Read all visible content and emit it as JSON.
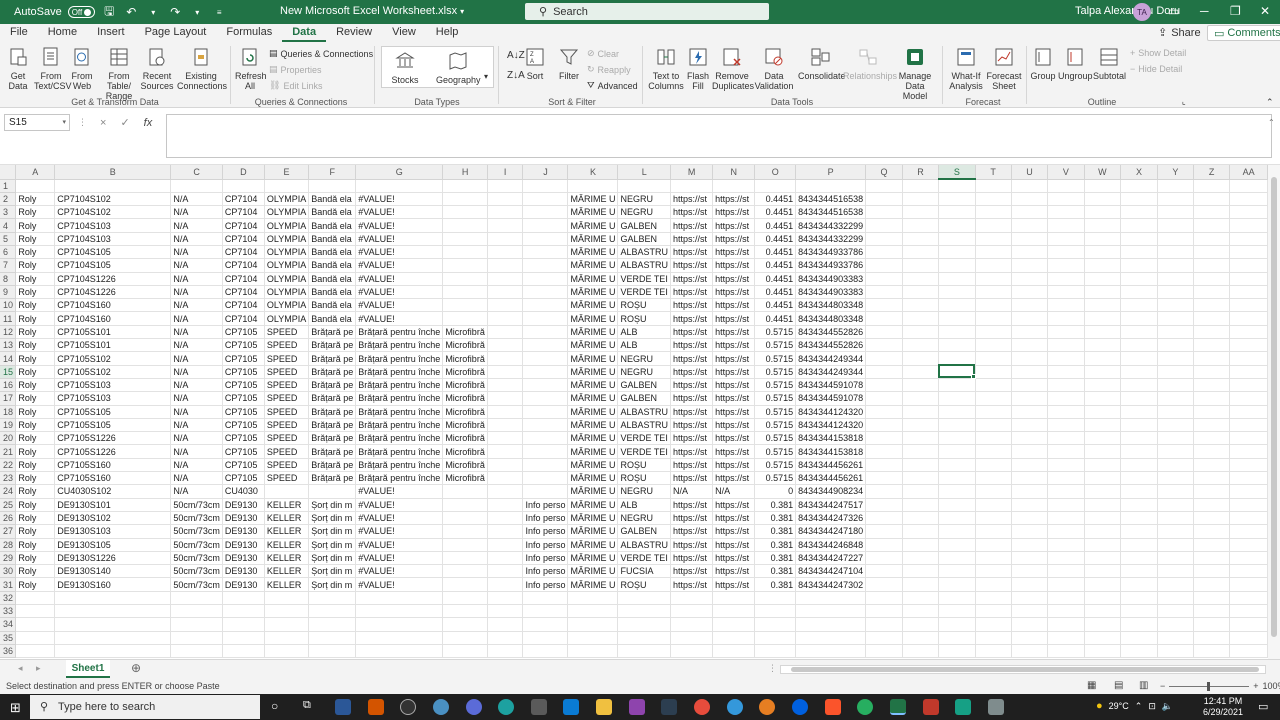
{
  "titlebar": {
    "autosave_label": "AutoSave",
    "autosave_state": "Off",
    "filename": "New Microsoft Excel Worksheet.xlsx",
    "search_placeholder": "Search",
    "user": "Talpa Alexandru Doru",
    "avatar": "TA"
  },
  "menu": {
    "tabs": [
      "File",
      "Home",
      "Insert",
      "Page Layout",
      "Formulas",
      "Data",
      "Review",
      "View",
      "Help"
    ],
    "active": "Data",
    "share": "Share",
    "comments": "Comments"
  },
  "ribbon": {
    "get_data": "Get Data",
    "from_text": "From Text/CSV",
    "from_web": "From Web",
    "from_table": "From Table/ Range",
    "recent_sources": "Recent Sources",
    "existing_connections": "Existing Connections",
    "refresh_all": "Refresh All",
    "queries_connections": "Queries & Connections",
    "properties": "Properties",
    "edit_links": "Edit Links",
    "stocks": "Stocks",
    "geography": "Geography",
    "sort": "Sort",
    "filter": "Filter",
    "clear": "Clear",
    "reapply": "Reapply",
    "advanced": "Advanced",
    "text_to_columns": "Text to Columns",
    "flash_fill": "Flash Fill",
    "remove_duplicates": "Remove Duplicates",
    "data_validation": "Data Validation",
    "consolidate": "Consolidate",
    "relationships": "Relationships",
    "manage_data_model": "Manage Data Model",
    "what_if": "What-If Analysis",
    "forecast_sheet": "Forecast Sheet",
    "group": "Group",
    "ungroup": "Ungroup",
    "subtotal": "Subtotal",
    "show_detail": "Show Detail",
    "hide_detail": "Hide Detail",
    "groups": {
      "get_transform": "Get & Transform Data",
      "queries": "Queries & Connections",
      "data_types": "Data Types",
      "sort_filter": "Sort & Filter",
      "data_tools": "Data Tools",
      "forecast": "Forecast",
      "outline": "Outline"
    }
  },
  "formula_bar": {
    "name_box": "S15",
    "cancel_icon": "×",
    "enter_icon": "✓",
    "fx": "fx",
    "value": ""
  },
  "grid": {
    "columns": [
      "A",
      "B",
      "C",
      "D",
      "E",
      "F",
      "G",
      "H",
      "I",
      "J",
      "K",
      "L",
      "M",
      "N",
      "O",
      "P",
      "Q",
      "R",
      "S",
      "T",
      "U",
      "V",
      "W",
      "X",
      "Y",
      "Z",
      "AA"
    ],
    "selected_column": "S",
    "selected_row": "15",
    "rows": [
      {
        "n": "1",
        "c": [
          "",
          "",
          "",
          "",
          "",
          "",
          "",
          "",
          "",
          "",
          "",
          "",
          "",
          "",
          "",
          "",
          ""
        ]
      },
      {
        "n": "2",
        "c": [
          "Roly",
          "CP7104S102",
          "N/A",
          "CP7104",
          "OLYMPIA",
          "Bandă ela",
          "#VALUE!",
          "",
          "",
          "",
          "MĂRIME U",
          "NEGRU",
          "https://st",
          "https://st",
          "0.4451",
          "8434344516538",
          ""
        ]
      },
      {
        "n": "3",
        "c": [
          "Roly",
          "CP7104S102",
          "N/A",
          "CP7104",
          "OLYMPIA",
          "Bandă ela",
          "#VALUE!",
          "",
          "",
          "",
          "MĂRIME U",
          "NEGRU",
          "https://st",
          "https://st",
          "0.4451",
          "8434344516538",
          ""
        ]
      },
      {
        "n": "4",
        "c": [
          "Roly",
          "CP7104S103",
          "N/A",
          "CP7104",
          "OLYMPIA",
          "Bandă ela",
          "#VALUE!",
          "",
          "",
          "",
          "MĂRIME U",
          "GALBEN",
          "https://st",
          "https://st",
          "0.4451",
          "8434344332299",
          ""
        ]
      },
      {
        "n": "5",
        "c": [
          "Roly",
          "CP7104S103",
          "N/A",
          "CP7104",
          "OLYMPIA",
          "Bandă ela",
          "#VALUE!",
          "",
          "",
          "",
          "MĂRIME U",
          "GALBEN",
          "https://st",
          "https://st",
          "0.4451",
          "8434344332299",
          ""
        ]
      },
      {
        "n": "6",
        "c": [
          "Roly",
          "CP7104S105",
          "N/A",
          "CP7104",
          "OLYMPIA",
          "Bandă ela",
          "#VALUE!",
          "",
          "",
          "",
          "MĂRIME U",
          "ALBASTRU",
          "https://st",
          "https://st",
          "0.4451",
          "8434344933786",
          ""
        ]
      },
      {
        "n": "7",
        "c": [
          "Roly",
          "CP7104S105",
          "N/A",
          "CP7104",
          "OLYMPIA",
          "Bandă ela",
          "#VALUE!",
          "",
          "",
          "",
          "MĂRIME U",
          "ALBASTRU",
          "https://st",
          "https://st",
          "0.4451",
          "8434344933786",
          ""
        ]
      },
      {
        "n": "8",
        "c": [
          "Roly",
          "CP7104S1226",
          "N/A",
          "CP7104",
          "OLYMPIA",
          "Bandă ela",
          "#VALUE!",
          "",
          "",
          "",
          "MĂRIME U",
          "VERDE TEI",
          "https://st",
          "https://st",
          "0.4451",
          "8434344903383",
          ""
        ]
      },
      {
        "n": "9",
        "c": [
          "Roly",
          "CP7104S1226",
          "N/A",
          "CP7104",
          "OLYMPIA",
          "Bandă ela",
          "#VALUE!",
          "",
          "",
          "",
          "MĂRIME U",
          "VERDE TEI",
          "https://st",
          "https://st",
          "0.4451",
          "8434344903383",
          ""
        ]
      },
      {
        "n": "10",
        "c": [
          "Roly",
          "CP7104S160",
          "N/A",
          "CP7104",
          "OLYMPIA",
          "Bandă ela",
          "#VALUE!",
          "",
          "",
          "",
          "MĂRIME U",
          "ROȘU",
          "https://st",
          "https://st",
          "0.4451",
          "8434344803348",
          ""
        ]
      },
      {
        "n": "11",
        "c": [
          "Roly",
          "CP7104S160",
          "N/A",
          "CP7104",
          "OLYMPIA",
          "Bandă ela",
          "#VALUE!",
          "",
          "",
          "",
          "MĂRIME U",
          "ROȘU",
          "https://st",
          "https://st",
          "0.4451",
          "8434344803348",
          ""
        ]
      },
      {
        "n": "12",
        "c": [
          "Roly",
          "CP7105S101",
          "N/A",
          "CP7105",
          "SPEED",
          "Brățară pe",
          "Brățară pentru înche",
          "Microfibră",
          "",
          "",
          "MĂRIME U",
          "ALB",
          "https://st",
          "https://st",
          "0.5715",
          "8434344552826",
          ""
        ]
      },
      {
        "n": "13",
        "c": [
          "Roly",
          "CP7105S101",
          "N/A",
          "CP7105",
          "SPEED",
          "Brățară pe",
          "Brățară pentru înche",
          "Microfibră",
          "",
          "",
          "MĂRIME U",
          "ALB",
          "https://st",
          "https://st",
          "0.5715",
          "8434344552826",
          ""
        ]
      },
      {
        "n": "14",
        "c": [
          "Roly",
          "CP7105S102",
          "N/A",
          "CP7105",
          "SPEED",
          "Brățară pe",
          "Brățară pentru înche",
          "Microfibră",
          "",
          "",
          "MĂRIME U",
          "NEGRU",
          "https://st",
          "https://st",
          "0.5715",
          "8434344249344",
          ""
        ]
      },
      {
        "n": "15",
        "c": [
          "Roly",
          "CP7105S102",
          "N/A",
          "CP7105",
          "SPEED",
          "Brățară pe",
          "Brățară pentru înche",
          "Microfibră",
          "",
          "",
          "MĂRIME U",
          "NEGRU",
          "https://st",
          "https://st",
          "0.5715",
          "8434344249344",
          ""
        ]
      },
      {
        "n": "16",
        "c": [
          "Roly",
          "CP7105S103",
          "N/A",
          "CP7105",
          "SPEED",
          "Brățară pe",
          "Brățară pentru înche",
          "Microfibră",
          "",
          "",
          "MĂRIME U",
          "GALBEN",
          "https://st",
          "https://st",
          "0.5715",
          "8434344591078",
          ""
        ]
      },
      {
        "n": "17",
        "c": [
          "Roly",
          "CP7105S103",
          "N/A",
          "CP7105",
          "SPEED",
          "Brățară pe",
          "Brățară pentru înche",
          "Microfibră",
          "",
          "",
          "MĂRIME U",
          "GALBEN",
          "https://st",
          "https://st",
          "0.5715",
          "8434344591078",
          ""
        ]
      },
      {
        "n": "18",
        "c": [
          "Roly",
          "CP7105S105",
          "N/A",
          "CP7105",
          "SPEED",
          "Brățară pe",
          "Brățară pentru înche",
          "Microfibră",
          "",
          "",
          "MĂRIME U",
          "ALBASTRU",
          "https://st",
          "https://st",
          "0.5715",
          "8434344124320",
          ""
        ]
      },
      {
        "n": "19",
        "c": [
          "Roly",
          "CP7105S105",
          "N/A",
          "CP7105",
          "SPEED",
          "Brățară pe",
          "Brățară pentru înche",
          "Microfibră",
          "",
          "",
          "MĂRIME U",
          "ALBASTRU",
          "https://st",
          "https://st",
          "0.5715",
          "8434344124320",
          ""
        ]
      },
      {
        "n": "20",
        "c": [
          "Roly",
          "CP7105S1226",
          "N/A",
          "CP7105",
          "SPEED",
          "Brățară pe",
          "Brățară pentru înche",
          "Microfibră",
          "",
          "",
          "MĂRIME U",
          "VERDE TEI",
          "https://st",
          "https://st",
          "0.5715",
          "8434344153818",
          ""
        ]
      },
      {
        "n": "21",
        "c": [
          "Roly",
          "CP7105S1226",
          "N/A",
          "CP7105",
          "SPEED",
          "Brățară pe",
          "Brățară pentru înche",
          "Microfibră",
          "",
          "",
          "MĂRIME U",
          "VERDE TEI",
          "https://st",
          "https://st",
          "0.5715",
          "8434344153818",
          ""
        ]
      },
      {
        "n": "22",
        "c": [
          "Roly",
          "CP7105S160",
          "N/A",
          "CP7105",
          "SPEED",
          "Brățară pe",
          "Brățară pentru înche",
          "Microfibră",
          "",
          "",
          "MĂRIME U",
          "ROȘU",
          "https://st",
          "https://st",
          "0.5715",
          "8434344456261",
          ""
        ]
      },
      {
        "n": "23",
        "c": [
          "Roly",
          "CP7105S160",
          "N/A",
          "CP7105",
          "SPEED",
          "Brățară pe",
          "Brățară pentru înche",
          "Microfibră",
          "",
          "",
          "MĂRIME U",
          "ROȘU",
          "https://st",
          "https://st",
          "0.5715",
          "8434344456261",
          ""
        ]
      },
      {
        "n": "24",
        "c": [
          "Roly",
          "CU4030S102",
          "N/A",
          "CU4030",
          "",
          "",
          "#VALUE!",
          "",
          "",
          "",
          "MĂRIME U",
          "NEGRU",
          "N/A",
          "N/A",
          "0",
          "8434344908234",
          ""
        ]
      },
      {
        "n": "25",
        "c": [
          "Roly",
          "DE9130S101",
          "50cm/73cm",
          "DE9130",
          "KELLER",
          "Șorț din m",
          "#VALUE!",
          "",
          "",
          "Info perso",
          "MĂRIME U",
          "ALB",
          "https://st",
          "https://st",
          "0.381",
          "8434344247517",
          ""
        ]
      },
      {
        "n": "26",
        "c": [
          "Roly",
          "DE9130S102",
          "50cm/73cm",
          "DE9130",
          "KELLER",
          "Șorț din m",
          "#VALUE!",
          "",
          "",
          "Info perso",
          "MĂRIME U",
          "NEGRU",
          "https://st",
          "https://st",
          "0.381",
          "8434344247326",
          ""
        ]
      },
      {
        "n": "27",
        "c": [
          "Roly",
          "DE9130S103",
          "50cm/73cm",
          "DE9130",
          "KELLER",
          "Șorț din m",
          "#VALUE!",
          "",
          "",
          "Info perso",
          "MĂRIME U",
          "GALBEN",
          "https://st",
          "https://st",
          "0.381",
          "8434344247180",
          ""
        ]
      },
      {
        "n": "28",
        "c": [
          "Roly",
          "DE9130S105",
          "50cm/73cm",
          "DE9130",
          "KELLER",
          "Șorț din m",
          "#VALUE!",
          "",
          "",
          "Info perso",
          "MĂRIME U",
          "ALBASTRU",
          "https://st",
          "https://st",
          "0.381",
          "8434344246848",
          ""
        ]
      },
      {
        "n": "29",
        "c": [
          "Roly",
          "DE9130S1226",
          "50cm/73cm",
          "DE9130",
          "KELLER",
          "Șorț din m",
          "#VALUE!",
          "",
          "",
          "Info perso",
          "MĂRIME U",
          "VERDE TEI",
          "https://st",
          "https://st",
          "0.381",
          "8434344247227",
          ""
        ]
      },
      {
        "n": "30",
        "c": [
          "Roly",
          "DE9130S140",
          "50cm/73cm",
          "DE9130",
          "KELLER",
          "Șorț din m",
          "#VALUE!",
          "",
          "",
          "Info perso",
          "MĂRIME U",
          "FUCSIA",
          "https://st",
          "https://st",
          "0.381",
          "8434344247104",
          ""
        ]
      },
      {
        "n": "31",
        "c": [
          "Roly",
          "DE9130S160",
          "50cm/73cm",
          "DE9130",
          "KELLER",
          "Șorț din m",
          "#VALUE!",
          "",
          "",
          "Info perso",
          "MĂRIME U",
          "ROȘU",
          "https://st",
          "https://st",
          "0.381",
          "8434344247302",
          ""
        ]
      },
      {
        "n": "32",
        "c": []
      },
      {
        "n": "33",
        "c": []
      },
      {
        "n": "34",
        "c": []
      },
      {
        "n": "35",
        "c": []
      },
      {
        "n": "36",
        "c": []
      }
    ]
  },
  "sheets": {
    "tabs": [
      "Sheet1"
    ],
    "active": "Sheet1"
  },
  "statusbar": {
    "message": "Select destination and press ENTER or choose Paste",
    "zoom": "100%"
  },
  "taskbar": {
    "search_placeholder": "Type here to search",
    "temperature": "29°C",
    "time": "12:41 PM",
    "date": "6/29/2021"
  },
  "colors": {
    "accent": "#217346",
    "titlebar": "#217346",
    "taskbar": "#1f1f1f"
  }
}
